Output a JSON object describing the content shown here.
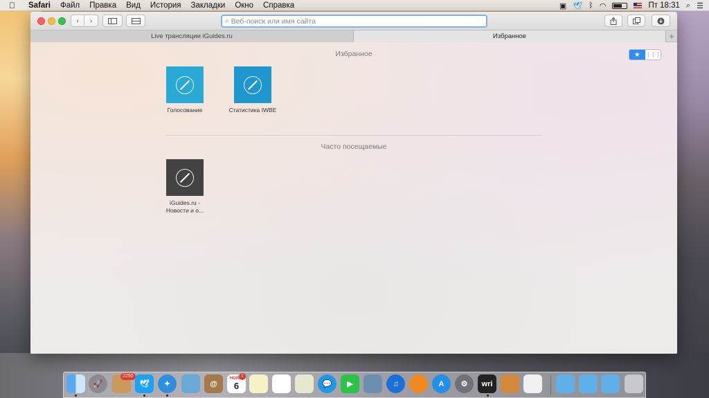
{
  "menubar": {
    "apple": "",
    "app_name": "Safari",
    "items": [
      "Файл",
      "Правка",
      "Вид",
      "История",
      "Закладки",
      "Окно",
      "Справка"
    ],
    "clock": "Пт 18:31"
  },
  "toolbar": {
    "back": "‹",
    "forward": "›",
    "search_placeholder": "Веб-поиск или имя сайта"
  },
  "tabs": [
    {
      "label": "Live трансляции iGuides.ru",
      "active": false
    },
    {
      "label": "Избранное",
      "active": true
    }
  ],
  "new_tab_label": "+",
  "favorites": {
    "title": "Избранное",
    "items": [
      {
        "label": "Голосование",
        "color": "#29a9d6"
      },
      {
        "label": "Статистика IWBE",
        "color": "#1e97cf"
      }
    ]
  },
  "frequent": {
    "title": "Часто посещаемые",
    "items": [
      {
        "label": "iGuides.ru - Новости и о...",
        "color": "#434343"
      }
    ]
  },
  "view_toggle": {
    "bookmarks": "★",
    "grid": "⋮⋮⋮"
  },
  "dock": {
    "badge_count": "2250",
    "calendar_month": "НОЯБ.",
    "calendar_day": "6",
    "calendar_badge": "1",
    "wri_label": "wri"
  }
}
